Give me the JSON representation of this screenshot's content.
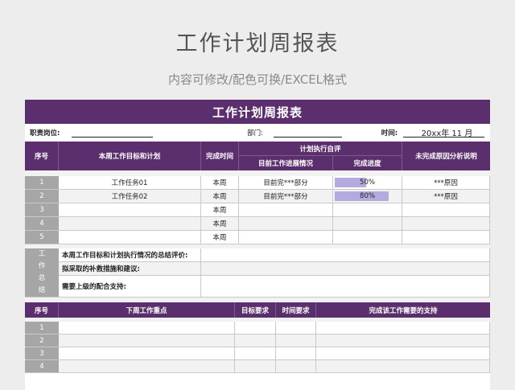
{
  "page": {
    "title": "工作计划周报表",
    "subtitle": "内容可修改/配色可换/EXCEL格式"
  },
  "sheet": {
    "banner": "工作计划周报表",
    "info": {
      "position_label": "职责岗位:",
      "dept_label": "部门:",
      "time_label": "时间:",
      "time_value": "20xx年 11 月"
    },
    "table1": {
      "headers": {
        "no": "序号",
        "goal": "本周工作目标和计划",
        "time": "完成时间",
        "eval_group": "计划执行自评",
        "progress_desc": "目前工作进展情况",
        "progress": "完成进度",
        "reason": "未完成原因分析说明"
      },
      "rows": [
        {
          "no": "1",
          "goal": "工作任务01",
          "time": "本周",
          "desc": "目前完***部分",
          "progress_text": "50%",
          "progress": 0.5,
          "reason": "***原因"
        },
        {
          "no": "2",
          "goal": "工作任务02",
          "time": "本周",
          "desc": "目前完***部分",
          "progress_text": "80%",
          "progress": 0.8,
          "reason": "***原因"
        },
        {
          "no": "3",
          "goal": "",
          "time": "本周",
          "desc": "",
          "progress_text": "",
          "progress": 0,
          "reason": ""
        },
        {
          "no": "4",
          "goal": "",
          "time": "本周",
          "desc": "",
          "progress_text": "",
          "progress": 0,
          "reason": ""
        },
        {
          "no": "5",
          "goal": "",
          "time": "本周",
          "desc": "",
          "progress_text": "",
          "progress": 0,
          "reason": ""
        }
      ]
    },
    "summary": {
      "side_label": [
        "工",
        "作",
        "总",
        "结"
      ],
      "rows": [
        "本周工作目标和计划执行情况的总结评价:",
        "拟采取的补救措施和建议:",
        "需要上级的配合支持:"
      ]
    },
    "table2": {
      "headers": {
        "no": "序号",
        "focus": "下周工作重点",
        "target": "目标要求",
        "time": "时间要求",
        "support": "完成该工作需要的支持"
      },
      "rows": [
        "1",
        "2",
        "3",
        "4"
      ]
    }
  }
}
